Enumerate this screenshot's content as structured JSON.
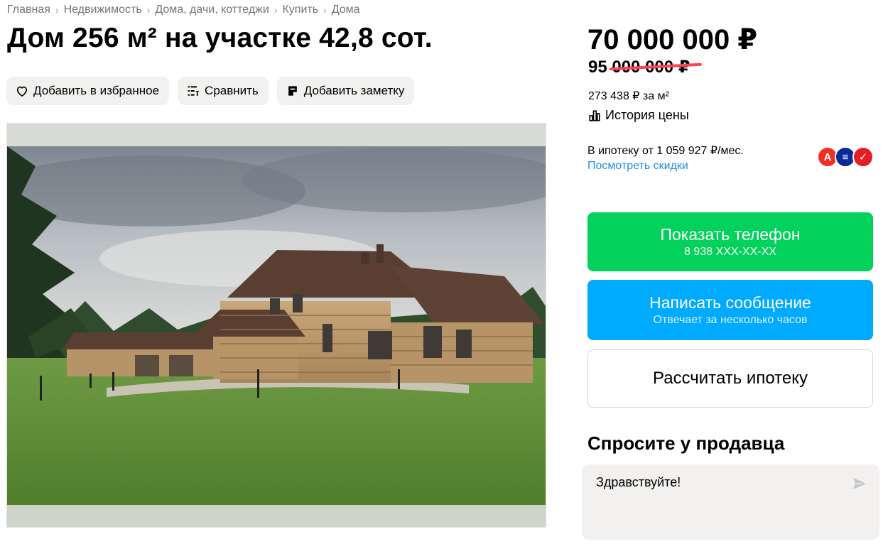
{
  "breadcrumbs": [
    "Главная",
    "Недвижимость",
    "Дома, дачи, коттеджи",
    "Купить",
    "Дома"
  ],
  "listing": {
    "title": "Дом 256 м² на участке 42,8 сот."
  },
  "actions": {
    "favorite_label": "Добавить в избранное",
    "compare_label": "Сравнить",
    "note_label": "Добавить заметку"
  },
  "price": {
    "current": "70 000 000 ₽",
    "old": "95 000 000 ₽",
    "per_meter": "273 438 ₽ за м²",
    "history_label": "История цены"
  },
  "mortgage": {
    "text": "В ипотеку от 1 059 927 ₽/мес.",
    "link": "Посмотреть скидки",
    "banks": [
      {
        "name": "alfa-bank-icon",
        "glyph": "А",
        "color": "#ef3124"
      },
      {
        "name": "vtb-bank-icon",
        "glyph": "≡",
        "color": "#0a2896"
      },
      {
        "name": "sovcombank-icon",
        "glyph": "✓",
        "color": "#e31e24"
      }
    ]
  },
  "buttons": {
    "phone_main": "Показать телефон",
    "phone_sub": "8 938 XXX-XX-XX",
    "message_main": "Написать сообщение",
    "message_sub": "Отвечает за несколько часов",
    "calc_label": "Рассчитать ипотеку"
  },
  "ask": {
    "title": "Спросите у продавца",
    "message": "Здравствуйте!"
  },
  "colors": {
    "green": "#02d15c",
    "blue": "#00aaff",
    "link": "#1f8fe5",
    "strike": "#ff4053",
    "chip_bg": "#f2f1f0"
  }
}
